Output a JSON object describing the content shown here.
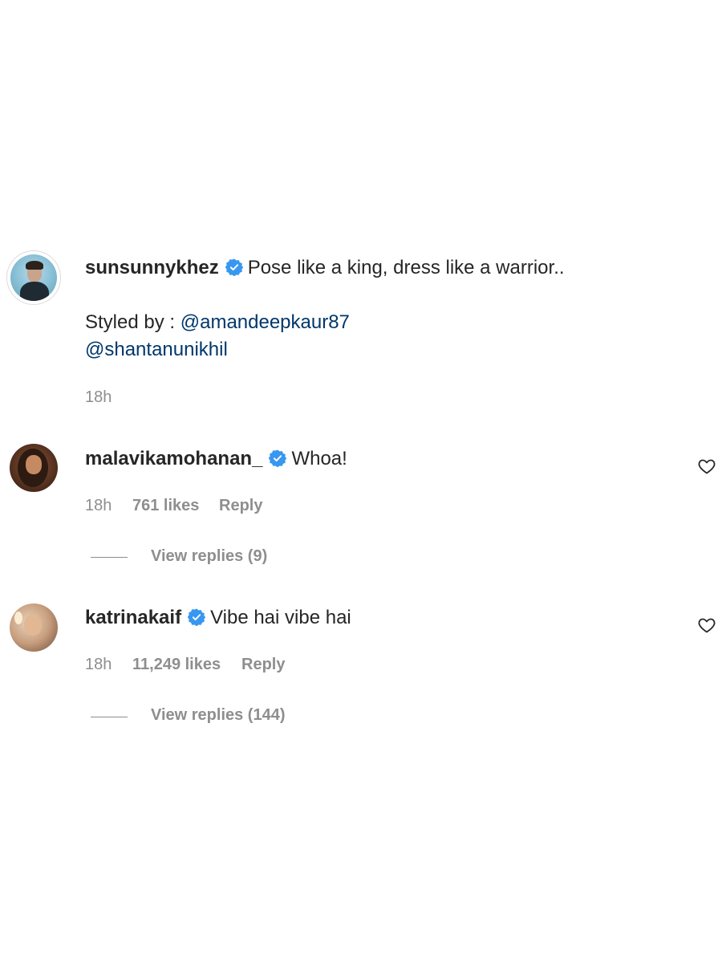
{
  "post": {
    "username": "sunsunnykhez",
    "caption": "Pose like a king, dress like a warrior..",
    "styled_by_label": "Styled by :",
    "mention_1": "@amandeepkaur87",
    "mention_2": "@shantanunikhil",
    "time": "18h"
  },
  "comments": [
    {
      "username": "malavikamohanan_",
      "text": "Whoa!",
      "time": "18h",
      "likes": "761 likes",
      "reply": "Reply",
      "view_replies": "View replies (9)"
    },
    {
      "username": "katrinakaif",
      "text": "Vibe hai vibe hai",
      "time": "18h",
      "likes": "11,249 likes",
      "reply": "Reply",
      "view_replies": "View replies (144)"
    }
  ],
  "colors": {
    "verified": "#3897f0",
    "mention": "#00376b",
    "muted": "#8e8e8e",
    "text": "#262626"
  }
}
